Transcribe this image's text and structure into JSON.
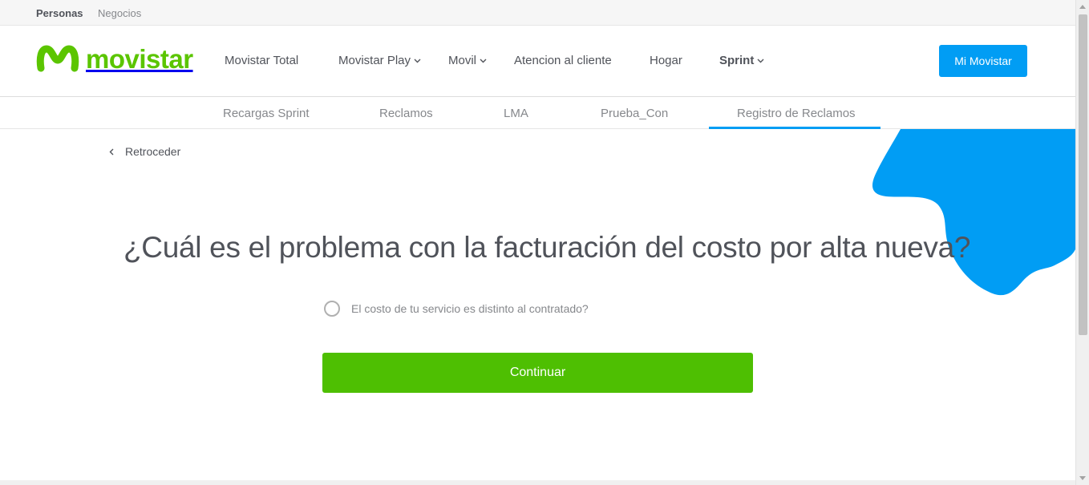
{
  "topbar": {
    "personas": "Personas",
    "negocios": "Negocios"
  },
  "header": {
    "logo_text": "movistar",
    "nav": [
      {
        "label": "Movistar Total",
        "dropdown": false
      },
      {
        "label": "Movistar Play",
        "dropdown": true
      },
      {
        "label": "Movil",
        "dropdown": true
      },
      {
        "label": "Atencion al cliente",
        "dropdown": false
      },
      {
        "label": "Hogar",
        "dropdown": false
      },
      {
        "label": "Sprint",
        "dropdown": true,
        "bold": true
      }
    ],
    "cta_label": "Mi Movistar"
  },
  "subnav": {
    "items": [
      {
        "label": "Recargas Sprint"
      },
      {
        "label": "Reclamos"
      },
      {
        "label": "LMA"
      },
      {
        "label": "Prueba_Con"
      },
      {
        "label": "Registro de Reclamos",
        "active": true
      }
    ]
  },
  "main": {
    "back_label": "Retroceder",
    "question": "¿Cuál es el problema con la facturación del costo por alta nueva?",
    "options": [
      {
        "label": "El costo de tu servicio es distinto al contratado?",
        "selected": false
      }
    ],
    "continue_label": "Continuar"
  },
  "colors": {
    "brand_green": "#5bc500",
    "accent_blue": "#019df4",
    "button_green": "#4ebf02",
    "text_dark": "#50535a",
    "text_muted": "#86888c"
  },
  "icons": {
    "logo": "movistar-m-icon",
    "chevron": "chevron-down-icon",
    "back": "chevron-left-icon",
    "radio": "radio-unchecked-icon"
  }
}
